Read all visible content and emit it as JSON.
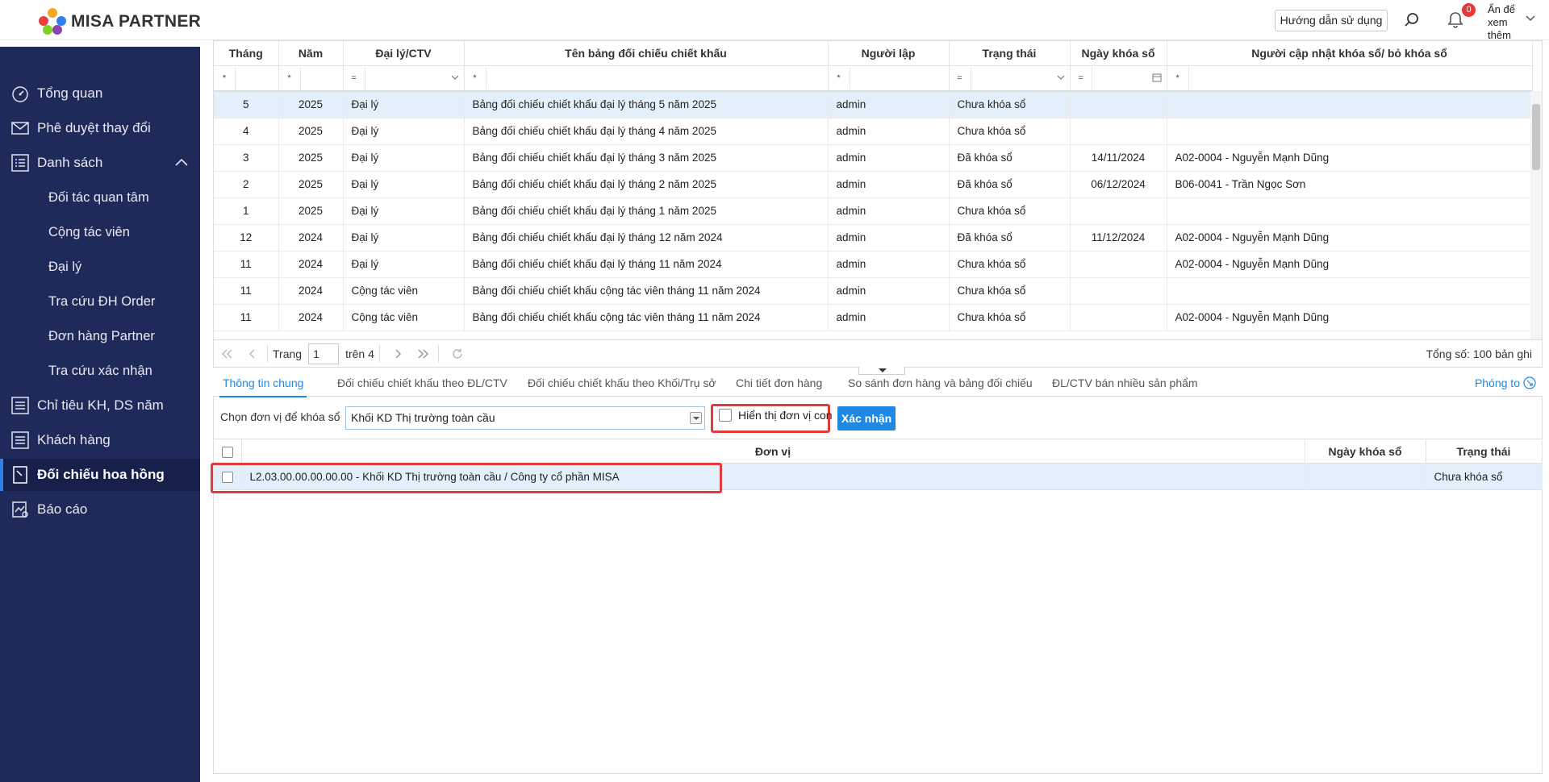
{
  "header": {
    "brand": "MISA PARTNER",
    "help_label": "Hướng dẫn sử dụng",
    "notification_count": "0",
    "user_toggle_label": "Ẩn để xem thêm"
  },
  "sidebar": {
    "items": [
      {
        "label": "Tổng quan",
        "icon": "gauge-icon"
      },
      {
        "label": "Phê duyệt thay đổi",
        "icon": "mail-icon"
      },
      {
        "label": "Danh sách",
        "icon": "list-icon"
      },
      {
        "label": "Đối tác quan tâm"
      },
      {
        "label": "Cộng tác viên"
      },
      {
        "label": "Đại lý"
      },
      {
        "label": "Tra cứu ĐH Order"
      },
      {
        "label": "Đơn hàng Partner"
      },
      {
        "label": "Tra cứu xác nhận"
      },
      {
        "label": "Chỉ tiêu KH, DS năm",
        "icon": "list-icon"
      },
      {
        "label": "Khách hàng",
        "icon": "list-icon"
      },
      {
        "label": "Đối chiếu hoa hồng",
        "icon": "document-icon"
      },
      {
        "label": "Báo cáo",
        "icon": "report-icon"
      }
    ]
  },
  "grid": {
    "columns": [
      "Tháng",
      "Năm",
      "Đại lý/CTV",
      "Tên bảng đối chiếu chiết khấu",
      "Người lập",
      "Trạng thái",
      "Ngày khóa sổ",
      "Người cập nhật khóa sổ/ bỏ khóa sổ"
    ],
    "filters": [
      "*",
      "*",
      "=",
      "*",
      "*",
      "=",
      "=",
      "*"
    ],
    "rows": [
      {
        "thang": "5",
        "nam": "2025",
        "loai": "Đại lý",
        "ten": "Bảng đối chiếu chiết khấu đại lý tháng 5 năm 2025",
        "nguoi_lap": "admin",
        "trang_thai": "Chưa khóa sổ",
        "ngay": "",
        "nguoi_cap_nhat": ""
      },
      {
        "thang": "4",
        "nam": "2025",
        "loai": "Đại lý",
        "ten": "Bảng đối chiếu chiết khấu đại lý tháng 4 năm 2025",
        "nguoi_lap": "admin",
        "trang_thai": "Chưa khóa sổ",
        "ngay": "",
        "nguoi_cap_nhat": ""
      },
      {
        "thang": "3",
        "nam": "2025",
        "loai": "Đại lý",
        "ten": "Bảng đối chiếu chiết khấu đại lý tháng 3 năm 2025",
        "nguoi_lap": "admin",
        "trang_thai": "Đã khóa sổ",
        "ngay": "14/11/2024",
        "nguoi_cap_nhat": "A02-0004 - Nguyễn Mạnh Dũng"
      },
      {
        "thang": "2",
        "nam": "2025",
        "loai": "Đại lý",
        "ten": "Bảng đối chiếu chiết khấu đại lý tháng 2 năm 2025",
        "nguoi_lap": "admin",
        "trang_thai": "Đã khóa sổ",
        "ngay": "06/12/2024",
        "nguoi_cap_nhat": "B06-0041 - Trần Ngọc Sơn"
      },
      {
        "thang": "1",
        "nam": "2025",
        "loai": "Đại lý",
        "ten": "Bảng đối chiếu chiết khấu đại lý tháng 1 năm 2025",
        "nguoi_lap": "admin",
        "trang_thai": "Chưa khóa sổ",
        "ngay": "",
        "nguoi_cap_nhat": ""
      },
      {
        "thang": "12",
        "nam": "2024",
        "loai": "Đại lý",
        "ten": "Bảng đối chiếu chiết khấu đại lý tháng 12 năm 2024",
        "nguoi_lap": "admin",
        "trang_thai": "Đã khóa sổ",
        "ngay": "11/12/2024",
        "nguoi_cap_nhat": "A02-0004 - Nguyễn Mạnh Dũng"
      },
      {
        "thang": "11",
        "nam": "2024",
        "loai": "Đại lý",
        "ten": "Bảng đối chiếu chiết khấu đại lý tháng 11 năm 2024",
        "nguoi_lap": "admin",
        "trang_thai": "Chưa khóa sổ",
        "ngay": "",
        "nguoi_cap_nhat": "A02-0004 - Nguyễn Mạnh Dũng"
      },
      {
        "thang": "11",
        "nam": "2024",
        "loai": "Cộng tác viên",
        "ten": "Bảng đối chiếu chiết khấu cộng tác viên tháng 11 năm 2024",
        "nguoi_lap": "admin",
        "trang_thai": "Chưa khóa sổ",
        "ngay": "",
        "nguoi_cap_nhat": ""
      },
      {
        "thang": "11",
        "nam": "2024",
        "loai": "Cộng tác viên",
        "ten": "Bảng đối chiếu chiết khấu cộng tác viên tháng 11 năm 2024",
        "nguoi_lap": "admin",
        "trang_thai": "Chưa khóa sổ",
        "ngay": "",
        "nguoi_cap_nhat": "A02-0004 - Nguyễn Mạnh Dũng"
      }
    ]
  },
  "pager": {
    "page_label": "Trang",
    "page_value": "1",
    "of_label": "trên 4",
    "total_label": "Tổng số: 100 bản ghi"
  },
  "tabs": {
    "items": [
      "Thông tin chung",
      "Đối chiếu chiết khấu theo ĐL/CTV",
      "Đối chiếu chiết khấu theo Khối/Trụ sở",
      "Chi tiết đơn hàng",
      "So sánh đơn hàng và bảng đối chiếu",
      "ĐL/CTV bán nhiều sản phẩm"
    ],
    "zoom_label": "Phóng to"
  },
  "panel": {
    "unit_label": "Chọn đơn vị để khóa sổ",
    "unit_value": "Khối KD Thị trường toàn cầu",
    "show_child_label": "Hiển thị đơn vị con",
    "confirm_label": "Xác nhận",
    "columns": [
      "Đơn vị",
      "Ngày khóa sổ",
      "Trạng thái"
    ],
    "rows": [
      {
        "don_vi": "L2.03.00.00.00.00.00 - Khối KD Thị trường toàn cầu / Công ty cổ phần MISA",
        "ngay": "",
        "trang_thai": "Chưa khóa sổ"
      }
    ]
  },
  "colors": {
    "sidebar_bg": "#1e2a5a",
    "accent": "#1e88e5",
    "selected_row": "#e3f0fb",
    "highlight": "#e23b3b"
  }
}
